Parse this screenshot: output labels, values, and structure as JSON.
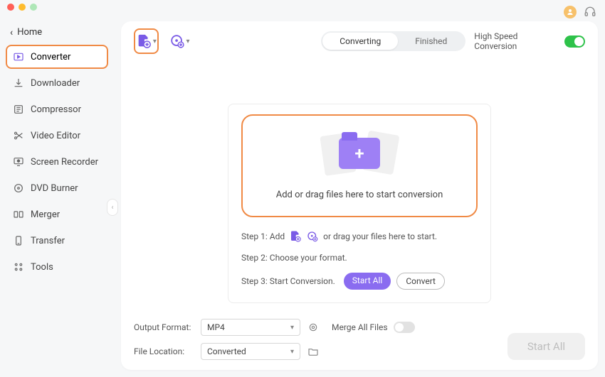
{
  "home_label": "Home",
  "sidebar": {
    "items": [
      {
        "label": "Converter"
      },
      {
        "label": "Downloader"
      },
      {
        "label": "Compressor"
      },
      {
        "label": "Video Editor"
      },
      {
        "label": "Screen Recorder"
      },
      {
        "label": "DVD Burner"
      },
      {
        "label": "Merger"
      },
      {
        "label": "Transfer"
      },
      {
        "label": "Tools"
      }
    ]
  },
  "segment": {
    "converting": "Converting",
    "finished": "Finished"
  },
  "high_speed_label": "High Speed Conversion",
  "dropzone_text": "Add or drag files here to start conversion",
  "steps": {
    "s1_prefix": "Step 1: Add",
    "s1_suffix": "or drag your files here to start.",
    "s2": "Step 2: Choose your format.",
    "s3_prefix": "Step 3: Start Conversion.",
    "start_all_btn": "Start  All",
    "convert_btn": "Convert"
  },
  "footer": {
    "output_label": "Output Format:",
    "output_value": "MP4",
    "location_label": "File Location:",
    "location_value": "Converted",
    "merge_label": "Merge All Files",
    "start_all": "Start All"
  }
}
